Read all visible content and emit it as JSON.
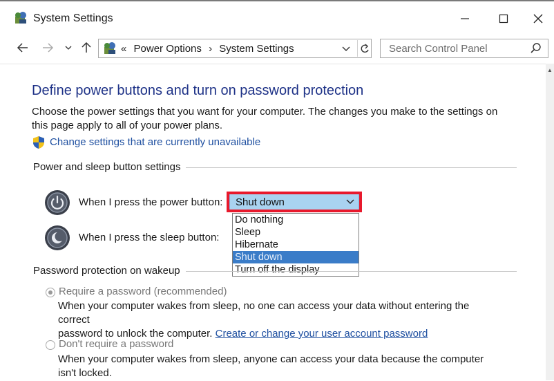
{
  "window": {
    "title": "System Settings"
  },
  "address": {
    "prefix": "«",
    "crumb1": "Power Options",
    "separator": "›",
    "crumb2": "System Settings"
  },
  "search": {
    "placeholder": "Search Control Panel"
  },
  "page": {
    "title": "Define power buttons and turn on password protection",
    "description": "Choose the power settings that you want for your computer. The changes you make to the settings on this page apply to all of your power plans.",
    "change_link": "Change settings that are currently unavailable"
  },
  "power_section": {
    "label": "Power and sleep button settings",
    "power_button_label": "When I press the power button:",
    "sleep_button_label": "When I press the sleep button:",
    "dropdown_value": "Shut down",
    "options": [
      "Do nothing",
      "Sleep",
      "Hibernate",
      "Shut down",
      "Turn off the display"
    ],
    "selected_index": 3
  },
  "password_section": {
    "label": "Password protection on wakeup",
    "require_label": "Require a password (recommended)",
    "require_text_1": "When your computer wakes from sleep, no one can access your data without entering the correct",
    "require_text_2": "password to unlock the computer. ",
    "require_link": "Create or change your user account password",
    "dont_require_label": "Don't require a password",
    "dont_text": "When your computer wakes from sleep, anyone can access your data because the computer isn't locked."
  },
  "colors": {
    "title_blue": "#1e3287",
    "link_blue": "#1e4fa0",
    "dropdown_bg": "#a9d3f0",
    "selection": "#3a7cc8",
    "highlight_red": "#e8192c"
  }
}
